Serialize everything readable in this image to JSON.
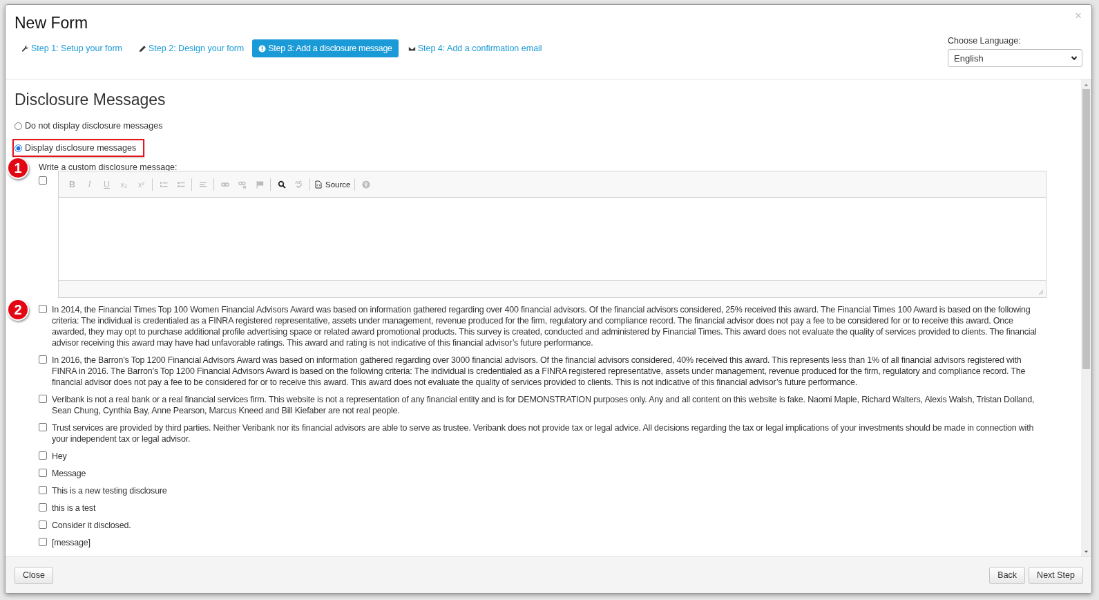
{
  "dialog": {
    "title": "New Form",
    "close_symbol": "×"
  },
  "steps": [
    {
      "label": "Step 1: Setup your form",
      "selected": false
    },
    {
      "label": "Step 2: Design your form",
      "selected": false
    },
    {
      "label": "Step 3: Add a disclosure message",
      "selected": true
    },
    {
      "label": "Step 4: Add a confirmation email",
      "selected": false
    }
  ],
  "language": {
    "label": "Choose Language:",
    "value": "English"
  },
  "section": {
    "heading": "Disclosure Messages",
    "display_options": [
      {
        "label": "Do not display disclosure messages",
        "selected": false,
        "highlighted": false
      },
      {
        "label": "Display disclosure messages",
        "selected": true,
        "highlighted": true
      }
    ],
    "custom_message": {
      "label": "Write a custom disclosure message:",
      "checked": false,
      "callout": "1",
      "toolbar": [
        {
          "kind": "bold",
          "label": "B",
          "disabled": true
        },
        {
          "kind": "italic",
          "label": "I",
          "disabled": true
        },
        {
          "kind": "underline",
          "label": "U",
          "disabled": true
        },
        {
          "kind": "subscript",
          "label": "x₂",
          "disabled": true
        },
        {
          "kind": "superscript",
          "label": "x²",
          "disabled": true
        },
        {
          "kind": "separator"
        },
        {
          "kind": "numbered-list",
          "disabled": true
        },
        {
          "kind": "bullet-list",
          "disabled": true
        },
        {
          "kind": "separator"
        },
        {
          "kind": "align",
          "disabled": true
        },
        {
          "kind": "separator"
        },
        {
          "kind": "link",
          "disabled": true
        },
        {
          "kind": "unlink",
          "disabled": true
        },
        {
          "kind": "flag",
          "disabled": true
        },
        {
          "kind": "separator"
        },
        {
          "kind": "search",
          "disabled": false
        },
        {
          "kind": "spellcheck",
          "disabled": true
        },
        {
          "kind": "separator"
        },
        {
          "kind": "source",
          "label": "Source",
          "disabled": false
        },
        {
          "kind": "separator"
        },
        {
          "kind": "accessibility",
          "disabled": true
        }
      ]
    },
    "messages": [
      {
        "text": "In 2014, the Financial Times Top 100 Women Financial Advisors Award was based on information gathered regarding over 400 financial advisors.  Of the financial advisors considered, 25% received this award. The Financial Times 100 Award is based on the following criteria: The individual is credentialed as a FINRA registered representative, assets under management, revenue produced for the firm, regulatory and compliance record. The financial advisor does not pay a fee to be considered for or to receive this award. Once awarded, they may opt to purchase additional profile advertising space or related award promotional products. This survey is created, conducted and administered by Financial Times. This award does not evaluate the quality of services provided to clients. The financial advisor receiving this award may have had unfavorable ratings. This award and rating is not indicative of this financial advisor’s future performance.",
        "checked": false,
        "callout": "2"
      },
      {
        "text": "In 2016, the Barron’s Top 1200 Financial Advisors Award was based on information gathered regarding over 3000 financial advisors. Of the financial advisors considered, 40% received this award. This represents less than 1% of all financial advisors registered with FINRA in 2016. The Barron’s Top 1200 Financial Advisors Award is based on the following criteria: The individual is credentialed as a FINRA registered representative, assets under management, revenue produced for the firm, regulatory and compliance record. The financial advisor does not pay a fee to be considered for or to receive this award. This award does not evaluate the quality of services provided to clients. This is not indicative of this financial advisor’s future performance.",
        "checked": false
      },
      {
        "text": "Veribank is not a real bank or a real financial services firm. This website is not a representation of any financial entity and is for DEMONSTRATION purposes only. Any and all content on this website is fake. Naomi Maple, Richard Walters, Alexis Walsh, Tristan Dolland, Sean Chung, Cynthia Bay, Anne Pearson, Marcus Kneed and Bill Kiefaber are not real people.",
        "checked": false
      },
      {
        "text": "Trust services are provided by third parties. Neither Veribank nor its financial advisors are able to serve as trustee. Veribank does not provide tax or legal advice. All decisions regarding the tax or legal implications of your investments should be made in connection with your independent tax or legal advisor.",
        "checked": false
      },
      {
        "text": "Hey",
        "checked": false
      },
      {
        "text": "Message",
        "checked": false
      },
      {
        "text": "This is a new testing disclosure",
        "checked": false
      },
      {
        "text": "this is a test",
        "checked": false
      },
      {
        "text": "Consider it disclosed.",
        "checked": false
      },
      {
        "text": "[message]",
        "checked": false
      }
    ]
  },
  "footer": {
    "close": "Close",
    "back": "Back",
    "next": "Next Step"
  }
}
